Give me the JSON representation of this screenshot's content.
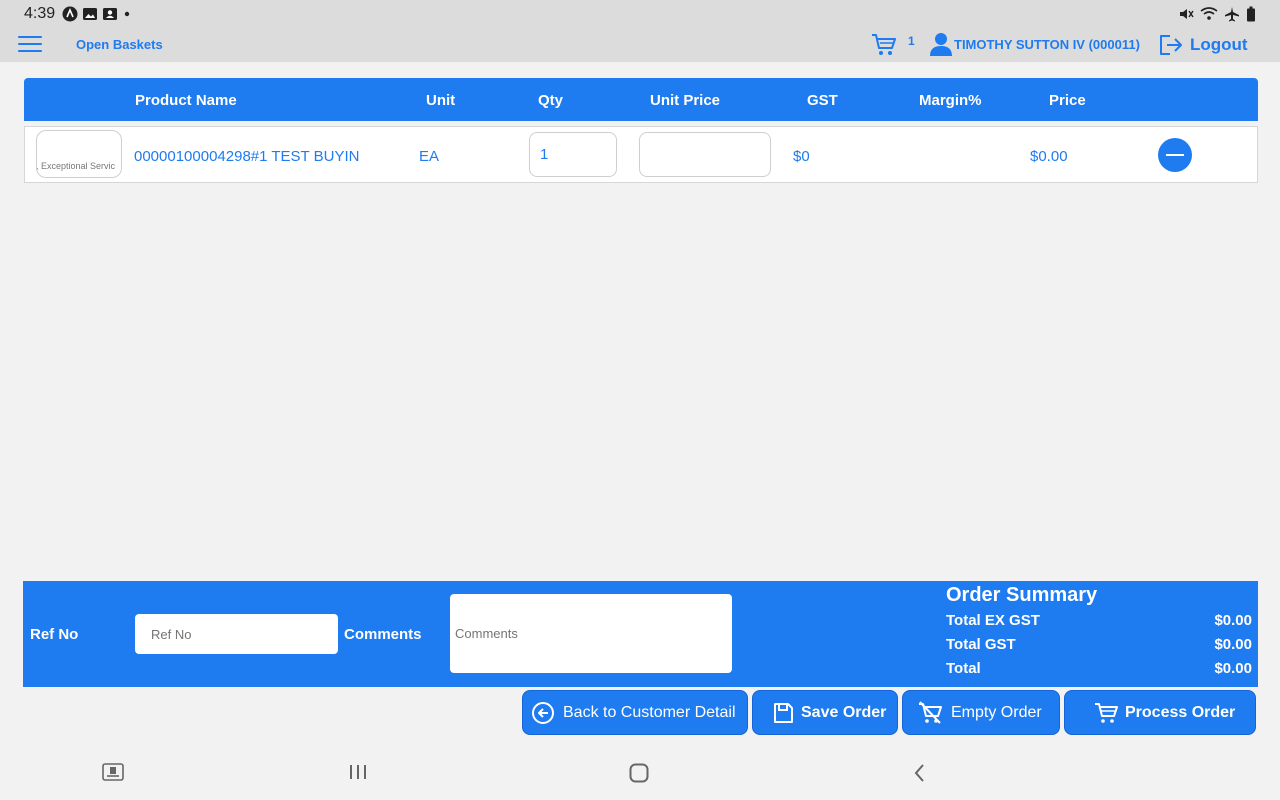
{
  "status_bar": {
    "time": "4:39"
  },
  "header": {
    "menu_icon": "hamburger-menu-icon",
    "open_baskets": "Open Baskets",
    "cart_count": "1",
    "user": "TIMOTHY SUTTON IV (000011)",
    "logout": "Logout"
  },
  "table": {
    "columns": [
      "Product Name",
      "Unit",
      "Qty",
      "Unit Price",
      "GST",
      "Margin%",
      "Price"
    ],
    "rows": [
      {
        "thumbnail_text": "n, Exceptional Servic",
        "product_name": "00000100004298#1 TEST BUYIN",
        "unit": "EA",
        "qty": "1",
        "unit_price": "",
        "gst": "$0",
        "margin": "",
        "price": "$0.00"
      }
    ]
  },
  "footer": {
    "ref_no_label": "Ref No",
    "ref_no_placeholder": "Ref No",
    "comments_label": "Comments",
    "comments_placeholder": "Comments",
    "summary": {
      "title": "Order Summary",
      "total_ex_gst_label": "Total EX GST",
      "total_ex_gst": "$0.00",
      "total_gst_label": "Total GST",
      "total_gst": "$0.00",
      "total_label": "Total",
      "total": "$0.00"
    }
  },
  "actions": {
    "back": "Back to Customer Detail",
    "save": "Save Order",
    "empty": "Empty Order",
    "process": "Process Order"
  },
  "colors": {
    "accent": "#1e7bf0",
    "background": "#f2f2f2",
    "header_bg": "#dcdcdc"
  }
}
